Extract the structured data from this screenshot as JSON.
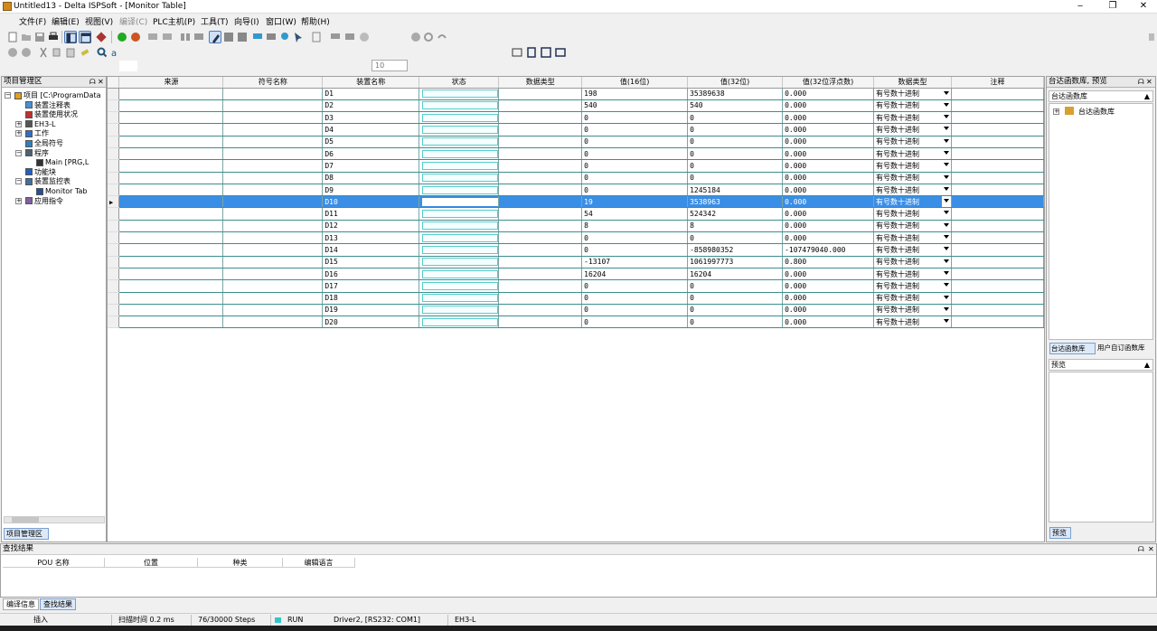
{
  "window": {
    "title": "Untitled13 - Delta ISPSoft - [Monitor Table]",
    "minimize": "‒",
    "restore": "❐",
    "close": "✕"
  },
  "menu": [
    {
      "label": "文件(F)",
      "enabled": true
    },
    {
      "label": "编辑(E)",
      "enabled": true
    },
    {
      "label": "视图(V)",
      "enabled": true
    },
    {
      "label": "编译(C)",
      "enabled": false
    },
    {
      "label": "PLC主机(P)",
      "enabled": true
    },
    {
      "label": "工具(T)",
      "enabled": true
    },
    {
      "label": "向导(I)",
      "enabled": true
    },
    {
      "label": "窗口(W)",
      "enabled": true
    },
    {
      "label": "帮助(H)",
      "enabled": true
    }
  ],
  "toolbar": {
    "scan_value": "10"
  },
  "project_panel": {
    "title": "项目管理区",
    "tab_label": "项目管理区",
    "tree": [
      {
        "label": "项目 [C:\\ProgramData",
        "level": 0,
        "icon": "project-icon"
      },
      {
        "label": "装置注释表",
        "level": 1,
        "icon": "comment-table-icon"
      },
      {
        "label": "装置使用状况",
        "level": 1,
        "icon": "device-usage-icon"
      },
      {
        "label": "EH3-L",
        "level": 1,
        "icon": "plc-icon"
      },
      {
        "label": "工作",
        "level": 1,
        "icon": "task-icon"
      },
      {
        "label": "全局符号",
        "level": 1,
        "icon": "global-symbol-icon"
      },
      {
        "label": "程序",
        "level": 1,
        "icon": "program-icon"
      },
      {
        "label": "Main [PRG,L",
        "level": 2,
        "icon": "pou-icon"
      },
      {
        "label": "功能块",
        "level": 1,
        "icon": "function-block-icon"
      },
      {
        "label": "装置监控表",
        "level": 1,
        "icon": "monitor-table-icon"
      },
      {
        "label": "Monitor Tab",
        "level": 2,
        "icon": "monitor-icon"
      },
      {
        "label": "应用指令",
        "level": 1,
        "icon": "instruction-icon"
      }
    ]
  },
  "monitor_table": {
    "columns": [
      "来源",
      "符号名称",
      "装置名称",
      "状态",
      "数据类型",
      "值(16位)",
      "值(32位)",
      "值(32位浮点数)",
      "数据类型",
      "注释"
    ],
    "selected_row": 9,
    "rows": [
      {
        "device": "D1",
        "v16": "198",
        "v32": "35389638",
        "vf": "0.000",
        "type": "有号数十进制"
      },
      {
        "device": "D2",
        "v16": "540",
        "v32": "540",
        "vf": "0.000",
        "type": "有号数十进制"
      },
      {
        "device": "D3",
        "v16": "0",
        "v32": "0",
        "vf": "0.000",
        "type": "有号数十进制"
      },
      {
        "device": "D4",
        "v16": "0",
        "v32": "0",
        "vf": "0.000",
        "type": "有号数十进制"
      },
      {
        "device": "D5",
        "v16": "0",
        "v32": "0",
        "vf": "0.000",
        "type": "有号数十进制"
      },
      {
        "device": "D6",
        "v16": "0",
        "v32": "0",
        "vf": "0.000",
        "type": "有号数十进制"
      },
      {
        "device": "D7",
        "v16": "0",
        "v32": "0",
        "vf": "0.000",
        "type": "有号数十进制"
      },
      {
        "device": "D8",
        "v16": "0",
        "v32": "0",
        "vf": "0.000",
        "type": "有号数十进制"
      },
      {
        "device": "D9",
        "v16": "0",
        "v32": "1245184",
        "vf": "0.000",
        "type": "有号数十进制"
      },
      {
        "device": "D10",
        "v16": "19",
        "v32": "3538963",
        "vf": "0.000",
        "type": "有号数十进制"
      },
      {
        "device": "D11",
        "v16": "54",
        "v32": "524342",
        "vf": "0.000",
        "type": "有号数十进制"
      },
      {
        "device": "D12",
        "v16": "8",
        "v32": "8",
        "vf": "0.000",
        "type": "有号数十进制"
      },
      {
        "device": "D13",
        "v16": "0",
        "v32": "0",
        "vf": "0.000",
        "type": "有号数十进制"
      },
      {
        "device": "D14",
        "v16": "0",
        "v32": "-858980352",
        "vf": "-107479040.000",
        "type": "有号数十进制"
      },
      {
        "device": "D15",
        "v16": "-13107",
        "v32": "1061997773",
        "vf": "0.800",
        "type": "有号数十进制"
      },
      {
        "device": "D16",
        "v16": "16204",
        "v32": "16204",
        "vf": "0.000",
        "type": "有号数十进制"
      },
      {
        "device": "D17",
        "v16": "0",
        "v32": "0",
        "vf": "0.000",
        "type": "有号数十进制"
      },
      {
        "device": "D18",
        "v16": "0",
        "v32": "0",
        "vf": "0.000",
        "type": "有号数十进制"
      },
      {
        "device": "D19",
        "v16": "0",
        "v32": "0",
        "vf": "0.000",
        "type": "有号数十进制"
      },
      {
        "device": "D20",
        "v16": "0",
        "v32": "0",
        "vf": "0.000",
        "type": "有号数十进制"
      }
    ]
  },
  "library_panel": {
    "title": "台达函数库, 预览",
    "section": "台达函数库",
    "tree_item": "台达函数库",
    "tab_delta": "台达函数库",
    "tab_user": "用户自订函数库",
    "preview_title": "预览",
    "preview_tab": "预览"
  },
  "find_panel": {
    "title": "查找结果",
    "columns": [
      "POU 名称",
      "位置",
      "种类",
      "编辑语言"
    ]
  },
  "bottom_tabs": [
    "编译信息",
    "查找结果"
  ],
  "status_bar": {
    "mode": "插入",
    "scan_time": "扫描时间 0.2 ms",
    "steps": "76/30000 Steps",
    "run_state": "RUN",
    "driver": "Driver2, [RS232: COM1]",
    "model": "EH3-L"
  },
  "colors": {
    "selection": "#3a8ee6",
    "grid_line": "#3d8e8e",
    "run_indicator": "#31c7c7"
  }
}
